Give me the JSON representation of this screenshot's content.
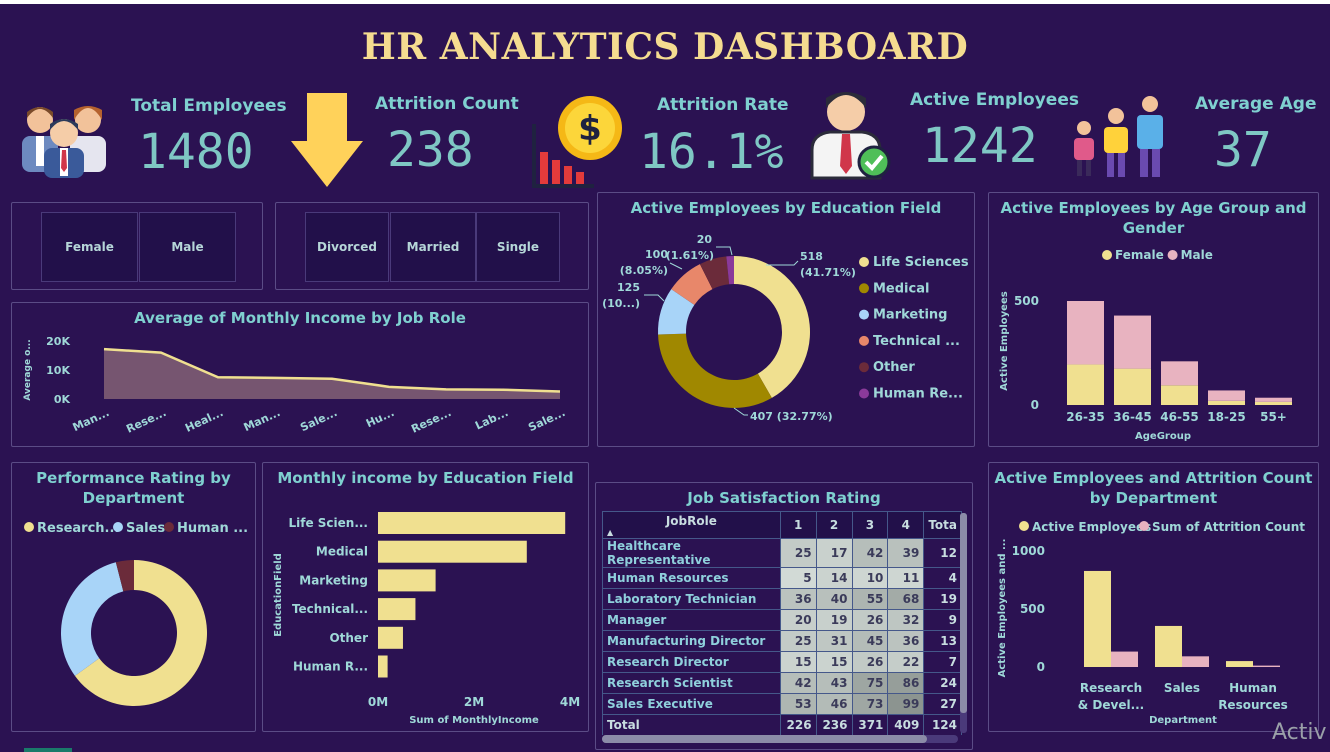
{
  "title": "HR ANALYTICS DASHBOARD",
  "kpis": {
    "total_employees": {
      "label": "Total Employees",
      "value": "1480"
    },
    "attrition_count": {
      "label": "Attrition Count",
      "value": "238"
    },
    "attrition_rate": {
      "label": "Attrition Rate",
      "value": "16.1%"
    },
    "active_employees": {
      "label": "Active Employees",
      "value": "1242"
    },
    "average_age": {
      "label": "Average Age",
      "value": "37"
    }
  },
  "slicers": {
    "gender": [
      "Female",
      "Male"
    ],
    "marital": [
      "Divorced",
      "Married",
      "Single"
    ]
  },
  "colors": {
    "background": "#2b1252",
    "accent_yellow": "#f0e090",
    "pink": "#e8b3c0",
    "light_blue": "#a8d4f8",
    "olive": "#a08800",
    "orange": "#e8876a",
    "maroon": "#6b2b3a",
    "purple": "#8a3a9a",
    "teal_text": "#7fd0d0"
  },
  "footer_text": "Activ",
  "chart_data": [
    {
      "id": "income_by_role",
      "type": "area",
      "title": "Average of Monthly Income by Job Role",
      "ylabel": "Average o...",
      "categories": [
        "Man...",
        "Rese...",
        "Heal...",
        "Man...",
        "Sale...",
        "Hu...",
        "Rese...",
        "Lab...",
        "Sale..."
      ],
      "values": [
        17200,
        16000,
        7500,
        7300,
        7000,
        4200,
        3300,
        3200,
        2600
      ],
      "yticks": [
        "20K",
        "10K",
        "0K"
      ],
      "ylim": [
        0,
        20000
      ]
    },
    {
      "id": "edu_field_donut",
      "type": "pie",
      "title": "Active Employees by Education Field",
      "slices": [
        {
          "name": "Life Sciences",
          "value": 518,
          "label": "518",
          "label2": "(41.71%)",
          "color": "#f0e090"
        },
        {
          "name": "Medical",
          "value": 407,
          "label": "407 (32.77%)",
          "label2": "",
          "color": "#a08800"
        },
        {
          "name": "Marketing",
          "value": 125,
          "label": "125",
          "label2": "(10...)",
          "color": "#a8d4f8"
        },
        {
          "name": "Technical ...",
          "value": 100,
          "label": "100",
          "label2": "(8.05%)",
          "color": "#e8876a"
        },
        {
          "name": "Other",
          "value": 72,
          "label": "",
          "label2": "",
          "color": "#6b2b3a"
        },
        {
          "name": "Human Re...",
          "value": 20,
          "label": "20",
          "label2": "(1.61%)",
          "color": "#8a3a9a"
        }
      ]
    },
    {
      "id": "age_gender",
      "type": "bar",
      "title": "Active Employees by Age Group and Gender",
      "xlabel": "AgeGroup",
      "ylabel": "Active Employees",
      "categories": [
        "26-35",
        "36-45",
        "46-55",
        "18-25",
        "55+"
      ],
      "series": [
        {
          "name": "Female",
          "values": [
            195,
            175,
            95,
            20,
            15
          ],
          "color": "#f0e090"
        },
        {
          "name": "Male",
          "values": [
            305,
            255,
            115,
            50,
            20
          ],
          "color": "#e8b3c0"
        }
      ],
      "yticks": [
        "500",
        "0"
      ],
      "ylim": [
        0,
        500
      ]
    },
    {
      "id": "perf_rating",
      "type": "pie",
      "title": "Performance Rating by Department",
      "slices": [
        {
          "name": "Research...",
          "value": 65,
          "color": "#f0e090"
        },
        {
          "name": "Sales",
          "value": 31,
          "color": "#a8d4f8"
        },
        {
          "name": "Human ...",
          "value": 4,
          "color": "#6b2b3a"
        }
      ]
    },
    {
      "id": "income_by_edu",
      "type": "bar",
      "title": "Monthly income by Education Field",
      "xlabel": "Sum of MonthlyIncome",
      "ylabel": "EducationField",
      "categories": [
        "Life Scien...",
        "Medical",
        "Marketing",
        "Technical...",
        "Other",
        "Human R..."
      ],
      "values": [
        3.9,
        3.1,
        1.2,
        0.78,
        0.52,
        0.2
      ],
      "xticks": [
        "0M",
        "2M",
        "4M"
      ],
      "xlim": [
        0,
        4
      ]
    },
    {
      "id": "job_satisfaction",
      "type": "table",
      "title": "Job Satisfaction Rating",
      "columns": [
        "JobRole",
        "1",
        "2",
        "3",
        "4",
        "Tota"
      ],
      "rows": [
        [
          "Healthcare Representative",
          "25",
          "17",
          "42",
          "39",
          "12"
        ],
        [
          "Human Resources",
          "5",
          "14",
          "10",
          "11",
          "4"
        ],
        [
          "Laboratory Technician",
          "36",
          "40",
          "55",
          "68",
          "19"
        ],
        [
          "Manager",
          "20",
          "19",
          "26",
          "32",
          "9"
        ],
        [
          "Manufacturing Director",
          "25",
          "31",
          "45",
          "36",
          "13"
        ],
        [
          "Research Director",
          "15",
          "15",
          "26",
          "22",
          "7"
        ],
        [
          "Research Scientist",
          "42",
          "43",
          "75",
          "86",
          "24"
        ],
        [
          "Sales Executive",
          "53",
          "46",
          "73",
          "99",
          "27"
        ]
      ],
      "total": [
        "Total",
        "226",
        "236",
        "371",
        "409",
        "124"
      ]
    },
    {
      "id": "dept_active_attrition",
      "type": "bar",
      "title": "Active Employees and Attrition Count by Department",
      "xlabel": "Department",
      "ylabel": "Active Employees and ...",
      "categories": [
        "Research & Devel...",
        "Sales",
        "Human Resources"
      ],
      "category_lines": [
        [
          "Research",
          "& Devel..."
        ],
        [
          "Sales",
          ""
        ],
        [
          "Human",
          "Resources"
        ]
      ],
      "series": [
        {
          "name": "Active Employees",
          "values": [
            828,
            354,
            51
          ],
          "color": "#f0e090"
        },
        {
          "name": "Sum of Attrition Count",
          "values": [
            133,
            92,
            12
          ],
          "color": "#e8b3c0"
        }
      ],
      "yticks": [
        "1000",
        "500",
        "0"
      ],
      "ylim": [
        0,
        1000
      ]
    }
  ]
}
